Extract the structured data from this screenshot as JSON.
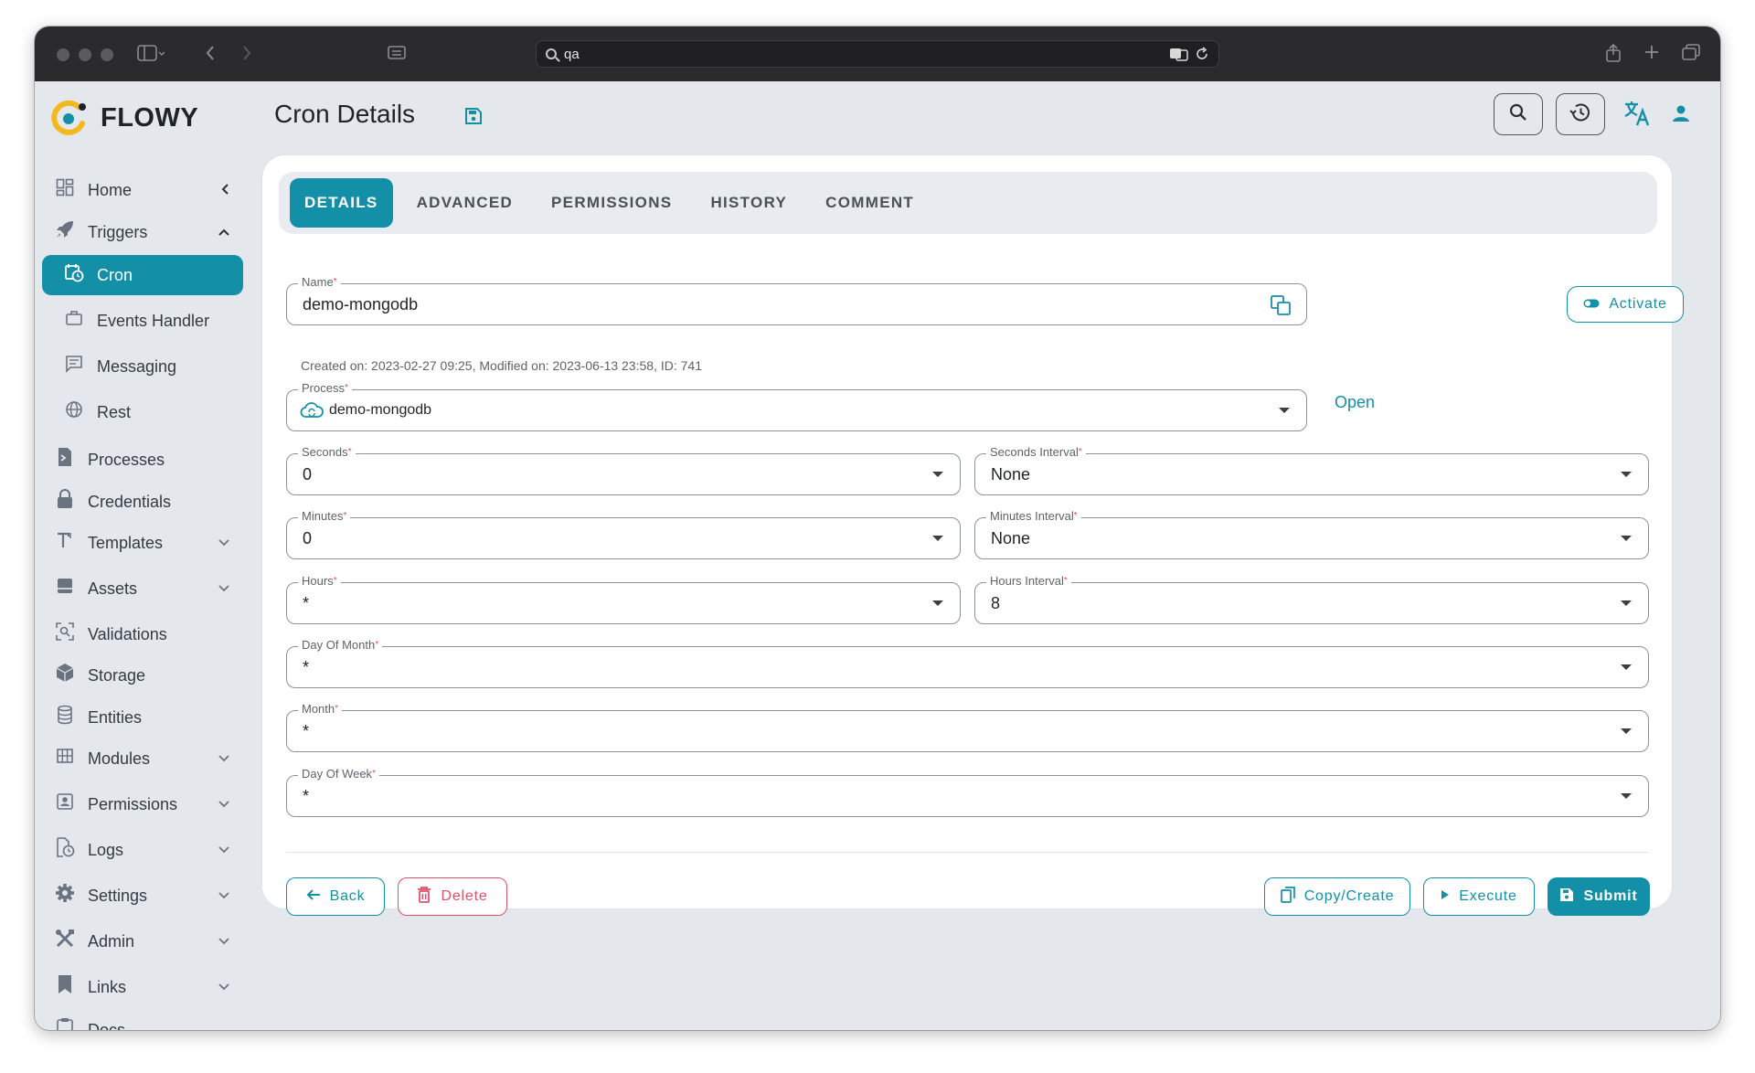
{
  "browser": {
    "address": "qa"
  },
  "app": {
    "name": "FLOWY"
  },
  "sidebar": {
    "items": [
      {
        "label": "Home",
        "icon": "dashboard-icon"
      },
      {
        "label": "Triggers",
        "icon": "rocket-icon"
      },
      {
        "label": "Cron",
        "icon": "clock-calendar-icon"
      },
      {
        "label": "Events Handler",
        "icon": "briefcase-icon"
      },
      {
        "label": "Messaging",
        "icon": "message-icon"
      },
      {
        "label": "Rest",
        "icon": "globe-icon"
      },
      {
        "label": "Processes",
        "icon": "terminal-icon"
      },
      {
        "label": "Credentials",
        "icon": "lock-icon"
      },
      {
        "label": "Templates",
        "icon": "text-format-icon"
      },
      {
        "label": "Assets",
        "icon": "inventory-icon"
      },
      {
        "label": "Validations",
        "icon": "scan-search-icon"
      },
      {
        "label": "Storage",
        "icon": "cube-icon"
      },
      {
        "label": "Entities",
        "icon": "database-icon"
      },
      {
        "label": "Modules",
        "icon": "grid-icon"
      },
      {
        "label": "Permissions",
        "icon": "account-box-icon"
      },
      {
        "label": "Logs",
        "icon": "file-clock-icon"
      },
      {
        "label": "Settings",
        "icon": "gear-icon"
      },
      {
        "label": "Admin",
        "icon": "tools-icon"
      },
      {
        "label": "Links",
        "icon": "bookmark-icon"
      },
      {
        "label": "Docs",
        "icon": "clipboard-icon"
      }
    ]
  },
  "header": {
    "title": "Cron Details"
  },
  "tabs": [
    "DETAILS",
    "ADVANCED",
    "PERMISSIONS",
    "HISTORY",
    "COMMENT"
  ],
  "form": {
    "name": {
      "label": "Name",
      "value": "demo-mongodb"
    },
    "meta": "Created on: 2023-02-27 09:25, Modified on: 2023-06-13 23:58, ID: 741",
    "activate_label": "Activate",
    "process": {
      "label": "Process",
      "value": "demo-mongodb"
    },
    "open_label": "Open",
    "seconds": {
      "label": "Seconds",
      "value": "0"
    },
    "seconds_interval": {
      "label": "Seconds Interval",
      "value": "None"
    },
    "minutes": {
      "label": "Minutes",
      "value": "0"
    },
    "minutes_interval": {
      "label": "Minutes Interval",
      "value": "None"
    },
    "hours": {
      "label": "Hours",
      "value": "*"
    },
    "hours_interval": {
      "label": "Hours Interval",
      "value": "8"
    },
    "day_of_month": {
      "label": "Day Of Month",
      "value": "*"
    },
    "month": {
      "label": "Month",
      "value": "*"
    },
    "day_of_week": {
      "label": "Day Of Week",
      "value": "*"
    },
    "required_mark": "*"
  },
  "actions": {
    "back": "Back",
    "delete": "Delete",
    "copy_create": "Copy/Create",
    "execute": "Execute",
    "submit": "Submit"
  },
  "colors": {
    "accent": "#148fa8",
    "danger": "#e0506b"
  }
}
